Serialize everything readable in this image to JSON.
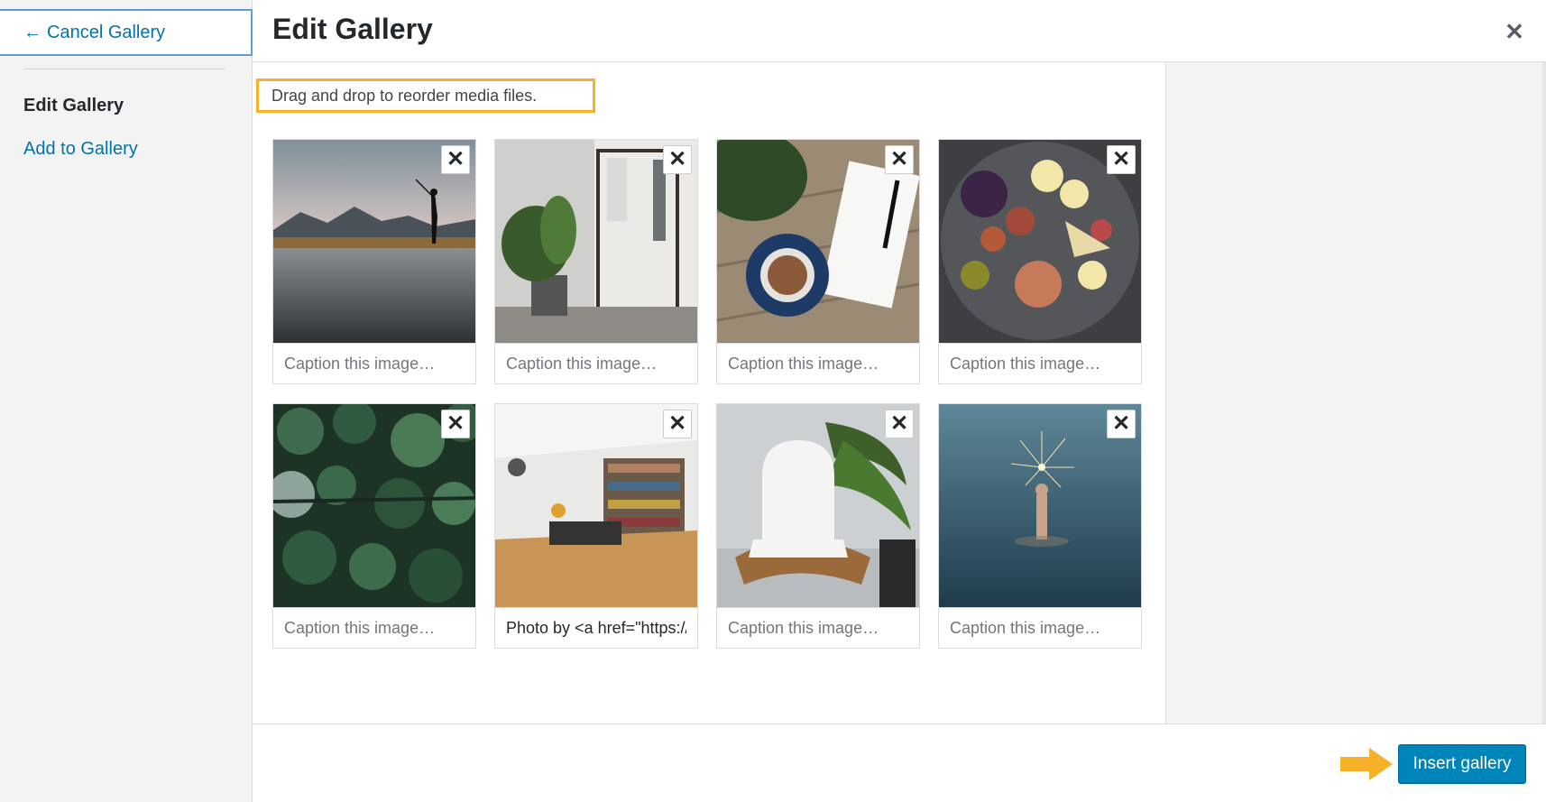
{
  "sidebar": {
    "cancel_label": "Cancel Gallery",
    "cancel_arrow": "←",
    "section_title": "Edit Gallery",
    "add_link": "Add to Gallery"
  },
  "header": {
    "title": "Edit Gallery",
    "close_icon": "✕"
  },
  "main": {
    "instructions": "Drag and drop to reorder media files.",
    "caption_placeholder": "Caption this image…",
    "remove_icon": "✕",
    "items": [
      {
        "subject": "fisherman-lake-mountains",
        "caption": ""
      },
      {
        "subject": "clothes-rack-plant",
        "caption": ""
      },
      {
        "subject": "coffee-notebook-pen",
        "caption": ""
      },
      {
        "subject": "food-platter",
        "caption": ""
      },
      {
        "subject": "aerial-forest",
        "caption": ""
      },
      {
        "subject": "living-room-bookshelf",
        "caption": "Photo by <a href=\"https://"
      },
      {
        "subject": "white-chair-palm",
        "caption": ""
      },
      {
        "subject": "hand-sparkler-sea",
        "caption": ""
      }
    ]
  },
  "toolbar": {
    "insert_label": "Insert gallery"
  },
  "colors": {
    "accent": "#0085ba",
    "link": "#0073aa",
    "highlight": "#f6b128"
  }
}
